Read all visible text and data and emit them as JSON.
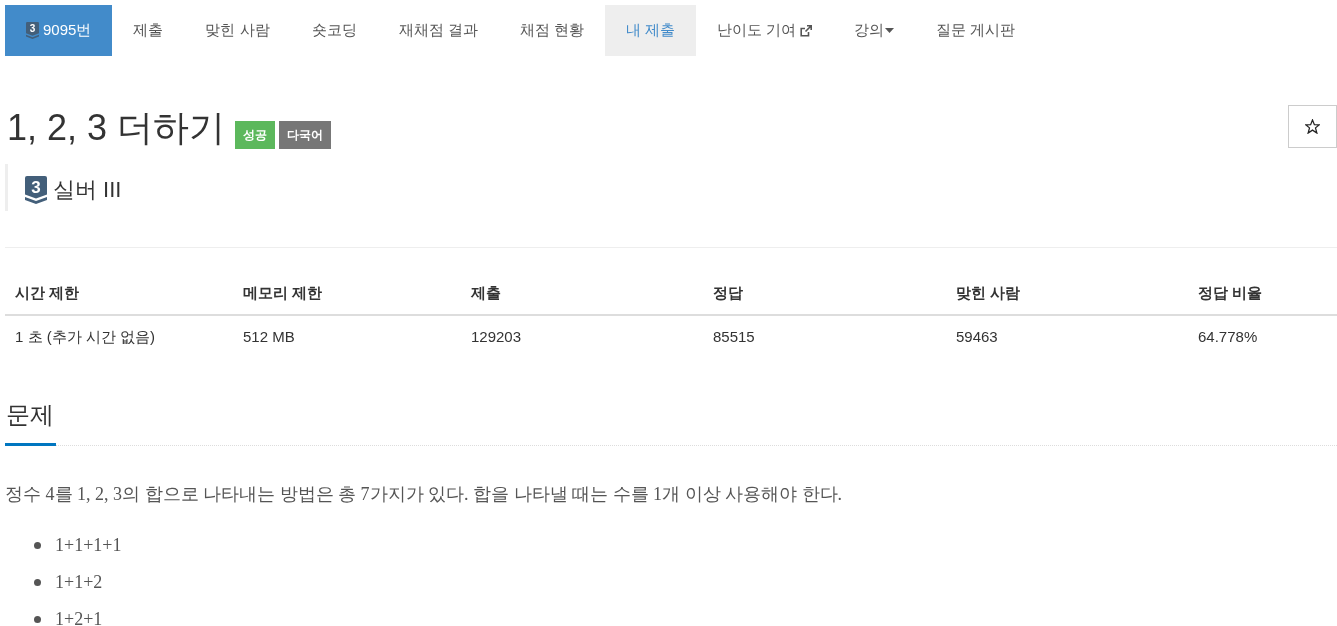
{
  "nav": {
    "tabs": [
      {
        "kind": "problem",
        "label": "9095번",
        "tier_badge": "3",
        "selected": true,
        "highlighted": false
      },
      {
        "kind": "link",
        "label": "제출",
        "selected": false,
        "highlighted": false
      },
      {
        "kind": "link",
        "label": "맞힌 사람",
        "selected": false,
        "highlighted": false
      },
      {
        "kind": "link",
        "label": "숏코딩",
        "selected": false,
        "highlighted": false
      },
      {
        "kind": "link",
        "label": "재채점 결과",
        "selected": false,
        "highlighted": false
      },
      {
        "kind": "link",
        "label": "채점 현황",
        "selected": false,
        "highlighted": false
      },
      {
        "kind": "link",
        "label": "내 제출",
        "selected": false,
        "highlighted": true
      },
      {
        "kind": "external",
        "label": "난이도 기여",
        "selected": false,
        "highlighted": false
      },
      {
        "kind": "dropdown",
        "label": "강의",
        "selected": false,
        "highlighted": false
      },
      {
        "kind": "link",
        "label": "질문 게시판",
        "selected": false,
        "highlighted": false
      }
    ]
  },
  "problem": {
    "title": "1, 2, 3 더하기",
    "badges": [
      {
        "label": "성공",
        "color": "#5cb85c"
      },
      {
        "label": "다국어",
        "color": "#777777"
      }
    ],
    "favorite_button": {
      "starred": false
    },
    "tier": {
      "badge": "3",
      "label": "실버 III"
    }
  },
  "info_table": {
    "columns": [
      "시간 제한",
      "메모리 제한",
      "제출",
      "정답",
      "맞힌 사람",
      "정답 비율"
    ],
    "rows": [
      [
        "1 초 (추가 시간 없음)",
        "512 MB",
        "129203",
        "85515",
        "59463",
        "64.778%"
      ]
    ]
  },
  "statement": {
    "heading": "문제",
    "paragraph": "정수 4를 1, 2, 3의 합으로 나타내는 방법은 총 7가지가 있다. 합을 나타낼 때는 수를 1개 이상 사용해야 한다.",
    "items": [
      "1+1+1+1",
      "1+1+2",
      "1+2+1"
    ]
  }
}
